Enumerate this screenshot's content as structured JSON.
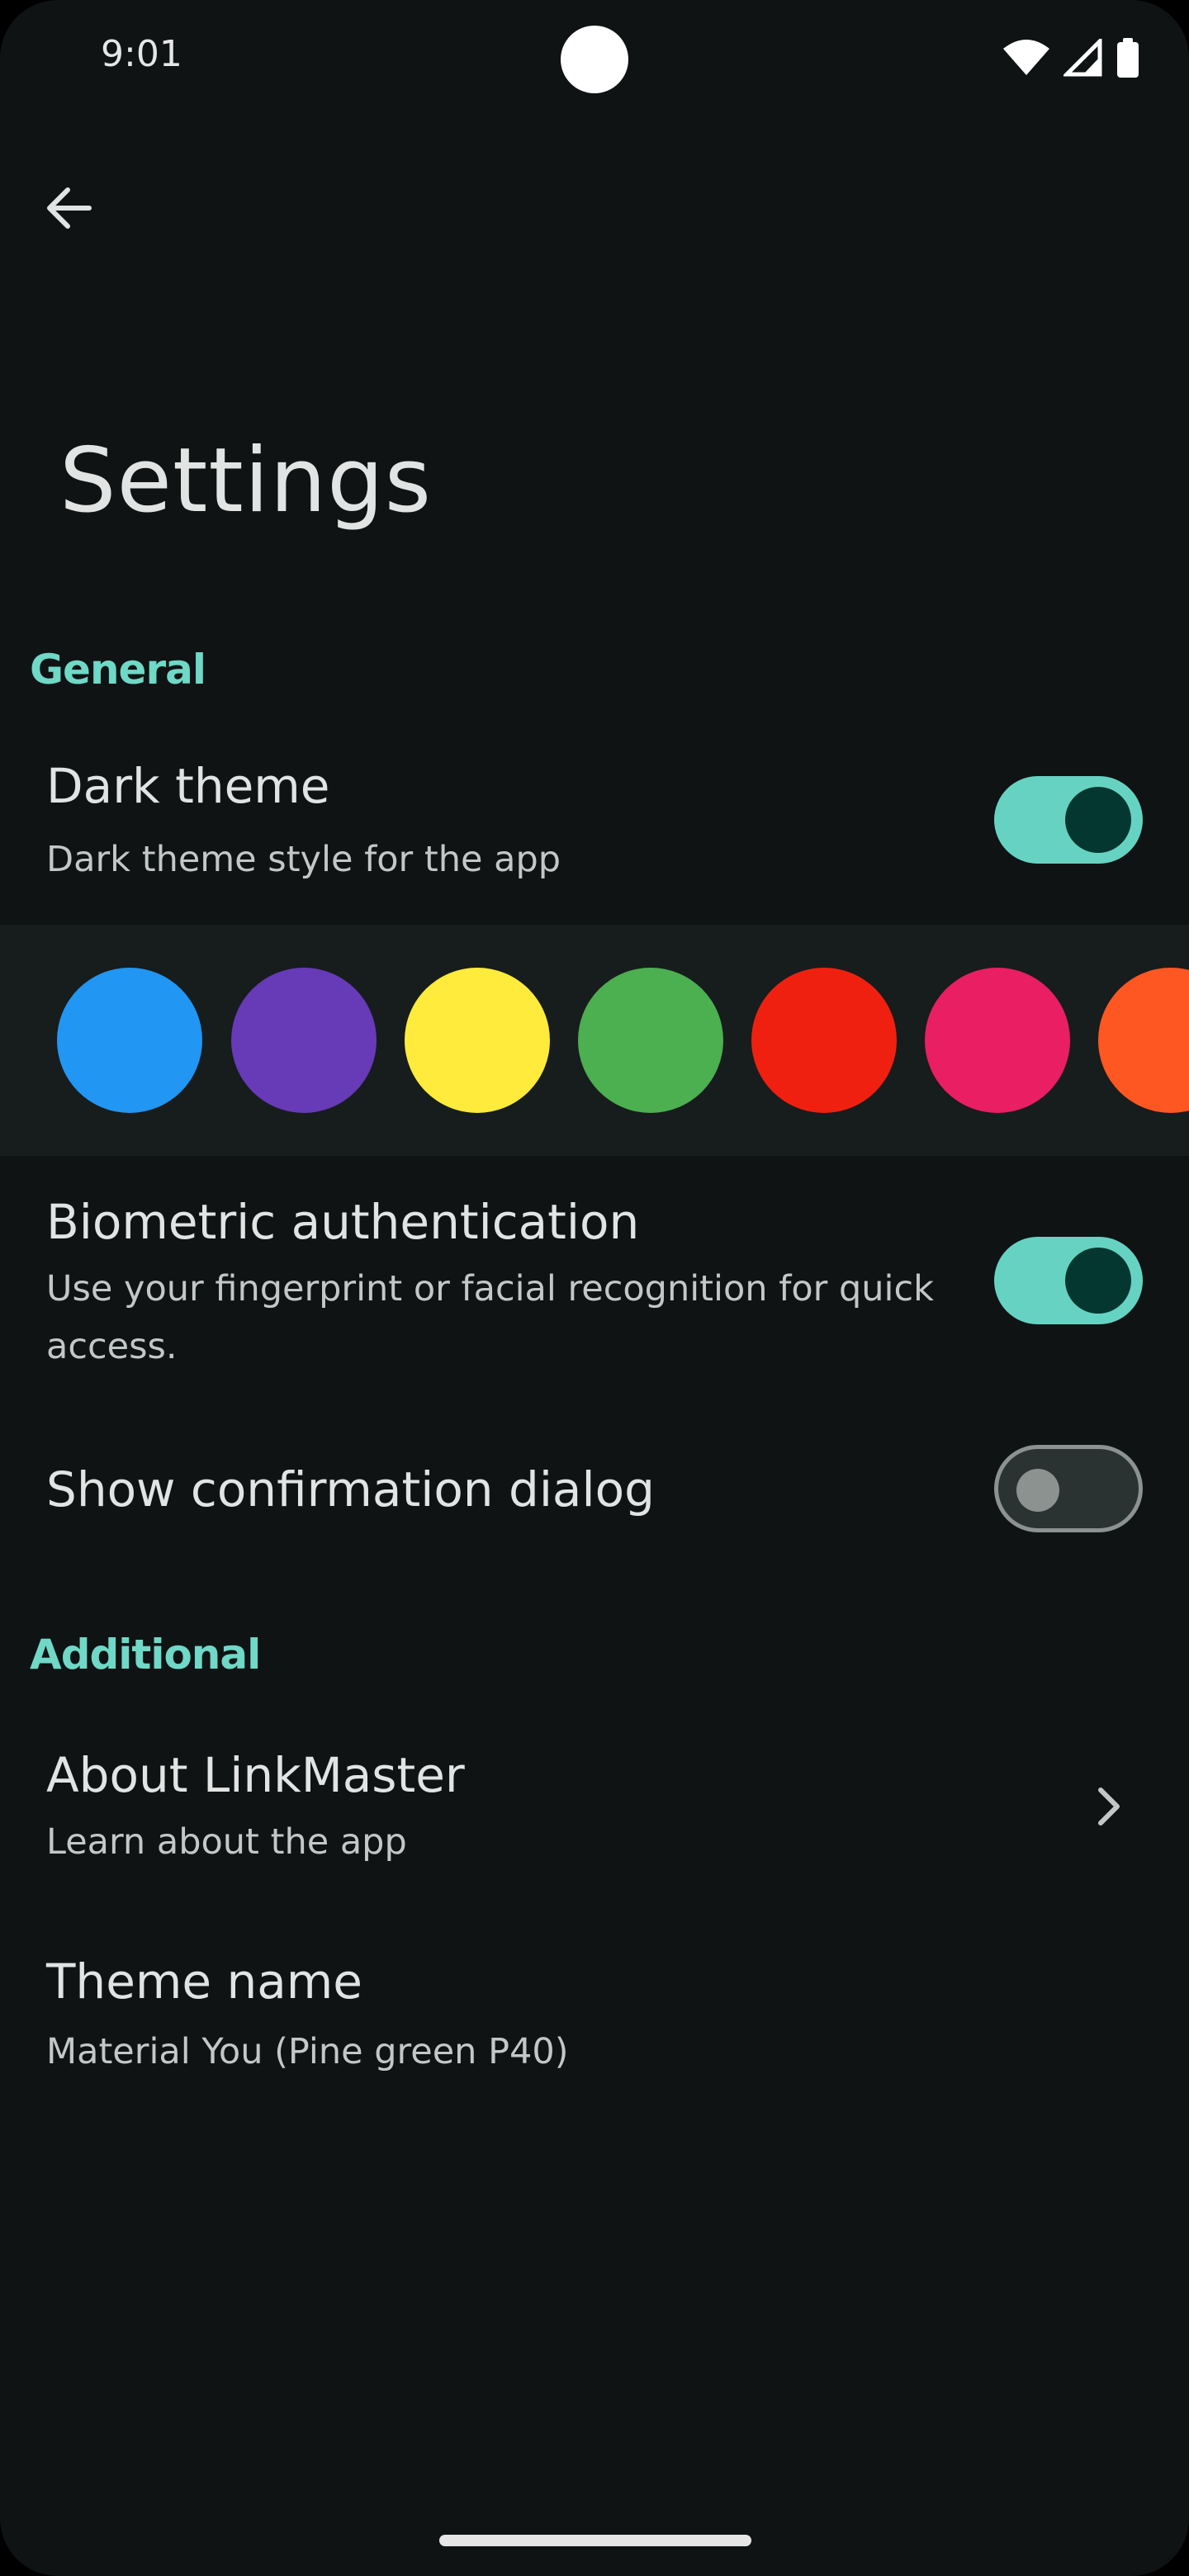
{
  "status_bar": {
    "time": "9:01",
    "icons": [
      "wifi-icon",
      "cellular-signal-icon",
      "battery-icon"
    ]
  },
  "header": {
    "back_icon": "arrow-back-icon",
    "title": "Settings"
  },
  "sections": {
    "general": {
      "label": "General",
      "dark_theme": {
        "title": "Dark theme",
        "subtitle": "Dark theme style for the app",
        "enabled": true
      },
      "theme_colors": [
        "#2196f3",
        "#673ab7",
        "#ffeb3b",
        "#4caf50",
        "#f02010",
        "#e91e63",
        "#ff5722"
      ],
      "biometric": {
        "title": "Biometric authentication",
        "subtitle_line1": "Use your fingerprint or facial recognition for quick",
        "subtitle_line2": "access.",
        "enabled": true
      },
      "confirmation": {
        "title": "Show confirmation dialog",
        "enabled": false
      }
    },
    "additional": {
      "label": "Additional",
      "about": {
        "title": "About LinkMaster",
        "subtitle": "Learn about the app",
        "chevron_icon": "chevron-right-icon"
      },
      "theme_name": {
        "title": "Theme name",
        "subtitle": "Material You (Pine green P40)"
      }
    }
  },
  "colors": {
    "background": "#0f1314",
    "accent": "#6fd8c6",
    "switch_track_on": "#66d3c2",
    "switch_thumb_on": "#053731",
    "swatch_strip": "#171c1c"
  }
}
